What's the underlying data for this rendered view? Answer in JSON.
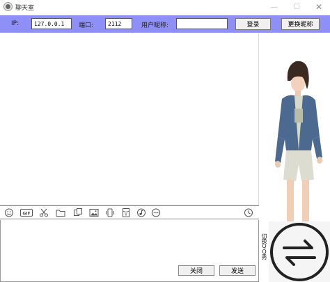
{
  "window": {
    "title": "聊天室",
    "minimize": "—",
    "maximize": "☐",
    "close": "✕"
  },
  "connection": {
    "ip_label": "IP:",
    "ip_value": "127.0.0.1",
    "port_label": "端口:",
    "port_value": "2112",
    "nickname_label": "用户昵称:",
    "nickname_value": "",
    "login_label": "登录",
    "change_nickname_label": "更换昵称"
  },
  "toolbar": {
    "icons": [
      "smiley-icon",
      "gif-icon",
      "scissors-icon",
      "folder-icon",
      "screenshot-icon",
      "image-icon",
      "shake-icon",
      "red-packet-icon",
      "music-icon",
      "more-icon",
      "history-clock-icon"
    ]
  },
  "input": {
    "close_label": "关闭",
    "send_label": "发送"
  },
  "side": {
    "switch_label": "切换QQ秀"
  }
}
